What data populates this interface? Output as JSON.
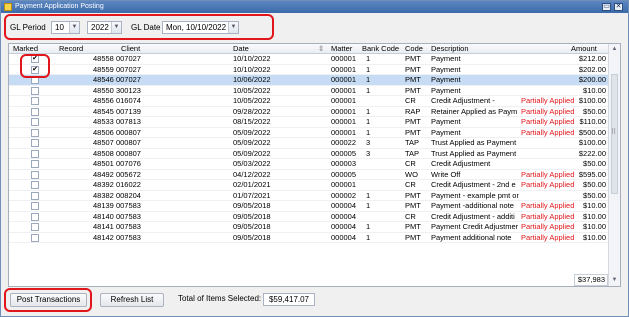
{
  "window": {
    "title": "Payment Application Posting"
  },
  "filters": {
    "gl_period_label": "GL Period",
    "gl_period_value": "10",
    "gl_year_value": "2022",
    "gl_date_label": "GL Date",
    "gl_date_value": "Mon, 10/10/2022"
  },
  "columns": [
    "Marked",
    "Record",
    "Client",
    "Date",
    "Matter",
    "Bank Code",
    "Code",
    "Description",
    "Amount"
  ],
  "rows": [
    {
      "marked": true,
      "client": "48558 007027",
      "date": "10/10/2022",
      "matter": "000001",
      "bank": "1",
      "code": "PMT",
      "desc": "Payment",
      "status": "",
      "amount": "$212.00",
      "selected": false
    },
    {
      "marked": true,
      "client": "48559 007027",
      "date": "10/10/2022",
      "matter": "000001",
      "bank": "1",
      "code": "PMT",
      "desc": "Payment",
      "status": "",
      "amount": "$202.00",
      "selected": false
    },
    {
      "marked": false,
      "client": "48546 007027",
      "date": "10/06/2022",
      "matter": "000001",
      "bank": "1",
      "code": "PMT",
      "desc": "Payment",
      "status": "",
      "amount": "$200.00",
      "selected": true
    },
    {
      "marked": false,
      "client": "48550 300123",
      "date": "10/05/2022",
      "matter": "000001",
      "bank": "1",
      "code": "PMT",
      "desc": "Payment",
      "status": "",
      "amount": "$10.00",
      "selected": false
    },
    {
      "marked": false,
      "client": "48556 016074",
      "date": "10/05/2022",
      "matter": "000001",
      "bank": "",
      "code": "CR",
      "desc": "Credit Adjustment -",
      "status": "Partially Applied",
      "amount": "$100.00",
      "selected": false
    },
    {
      "marked": false,
      "client": "48545 007139",
      "date": "09/28/2022",
      "matter": "000001",
      "bank": "1",
      "code": "RAP",
      "desc": "Retainer Applied as Paym",
      "status": "Partially Applied",
      "amount": "$50.00",
      "selected": false
    },
    {
      "marked": false,
      "client": "48533 007813",
      "date": "08/15/2022",
      "matter": "000001",
      "bank": "1",
      "code": "PMT",
      "desc": "Payment",
      "status": "Partially Applied",
      "amount": "$110.00",
      "selected": false
    },
    {
      "marked": false,
      "client": "48506 000807",
      "date": "05/09/2022",
      "matter": "000001",
      "bank": "1",
      "code": "PMT",
      "desc": "Payment",
      "status": "Partially Applied",
      "amount": "$500.00",
      "selected": false
    },
    {
      "marked": false,
      "client": "48507 000807",
      "date": "05/09/2022",
      "matter": "000022",
      "bank": "3",
      "code": "TAP",
      "desc": "Trust Applied as Payment",
      "status": "",
      "amount": "$100.00",
      "selected": false
    },
    {
      "marked": false,
      "client": "48508 000807",
      "date": "05/09/2022",
      "matter": "000005",
      "bank": "3",
      "code": "TAP",
      "desc": "Trust Applied as Payment",
      "status": "",
      "amount": "$222.00",
      "selected": false
    },
    {
      "marked": false,
      "client": "48501 007076",
      "date": "05/03/2022",
      "matter": "000003",
      "bank": "",
      "code": "CR",
      "desc": "Credit Adjustment",
      "status": "",
      "amount": "$50.00",
      "selected": false
    },
    {
      "marked": false,
      "client": "48492 005672",
      "date": "04/12/2022",
      "matter": "000005",
      "bank": "",
      "code": "WO",
      "desc": "Write Off",
      "status": "Partially Applied",
      "amount": "$595.00",
      "selected": false
    },
    {
      "marked": false,
      "client": "48392 016022",
      "date": "02/01/2021",
      "matter": "000001",
      "bank": "",
      "code": "CR",
      "desc": "Credit Adjustment - 2nd e",
      "status": "Partially Applied",
      "amount": "$50.00",
      "selected": false
    },
    {
      "marked": false,
      "client": "48382 008204",
      "date": "01/07/2021",
      "matter": "000002",
      "bank": "1",
      "code": "PMT",
      "desc": "Payment  - example pmt on 1-7",
      "status": "",
      "amount": "$50.00",
      "selected": false
    },
    {
      "marked": false,
      "client": "48139 007583",
      "date": "09/05/2018",
      "matter": "000004",
      "bank": "1",
      "code": "PMT",
      "desc": "Payment -additional note",
      "status": "Partially Applied",
      "amount": "$10.00",
      "selected": false
    },
    {
      "marked": false,
      "client": "48140 007583",
      "date": "09/05/2018",
      "matter": "000004",
      "bank": "",
      "code": "CR",
      "desc": "Credit Adjustment - additi",
      "status": "Partially Applied",
      "amount": "$10.00",
      "selected": false
    },
    {
      "marked": false,
      "client": "48141 007583",
      "date": "09/05/2018",
      "matter": "000004",
      "bank": "1",
      "code": "PMT",
      "desc": "Payment Credit Adjustmer",
      "status": "Partially Applied",
      "amount": "$10.00",
      "selected": false
    },
    {
      "marked": false,
      "client": "48142 007583",
      "date": "09/05/2018",
      "matter": "000004",
      "bank": "1",
      "code": "PMT",
      "desc": "Payment additional note",
      "status": "Partially Applied",
      "amount": "$10.00",
      "selected": false
    }
  ],
  "grid_total": "$37,983",
  "actions": {
    "post_label": "Post Transactions",
    "refresh_label": "Refresh List",
    "total_selected_label": "Total of Items Selected:",
    "total_selected_value": "$59,417.07"
  },
  "icons": {
    "sort": "sort-icon",
    "check": "checkmark-icon"
  },
  "colors": {
    "highlight": "#e0161b",
    "selected_row": "#c6dcf5",
    "titlebar": "#3c6aa8"
  }
}
